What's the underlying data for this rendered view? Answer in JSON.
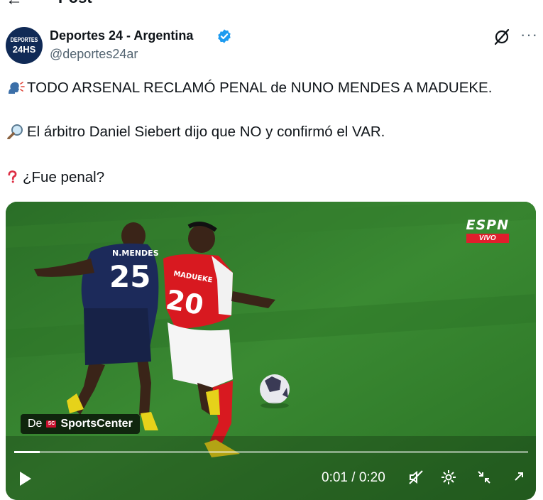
{
  "header": {
    "back_icon": "arrow-left-icon",
    "title": "Post"
  },
  "author": {
    "avatar_text_top": "DEPORTES",
    "avatar_text_bottom": "24HS",
    "display_name": "Deportes 24 - Argentina",
    "handle": "@deportes24ar",
    "verified": true
  },
  "tweet": {
    "line1": "TODO ARSENAL RECLAMÓ PENAL de NUNO MENDES A MADUEKE.",
    "line2": "El árbitro Daniel Siebert dijo que NO y confirmó el VAR.",
    "line3": "¿Fue penal?"
  },
  "media": {
    "broadcaster": "ESPN",
    "broadcast_status": "VIVO",
    "source_prefix": "De",
    "source_name": "SportsCenter",
    "player_left_name": "N.MENDES",
    "player_left_number": "25",
    "player_right_name": "MADUEKE",
    "player_right_number": "20",
    "progress": 0.05,
    "time_display": "0:01 / 0:20"
  },
  "colors": {
    "verified": "#1d9bf0",
    "pitch": "#2f7a2a",
    "arsenal_red": "#d81920",
    "psg_navy": "#1c2a5a",
    "text_secondary": "#536471"
  }
}
